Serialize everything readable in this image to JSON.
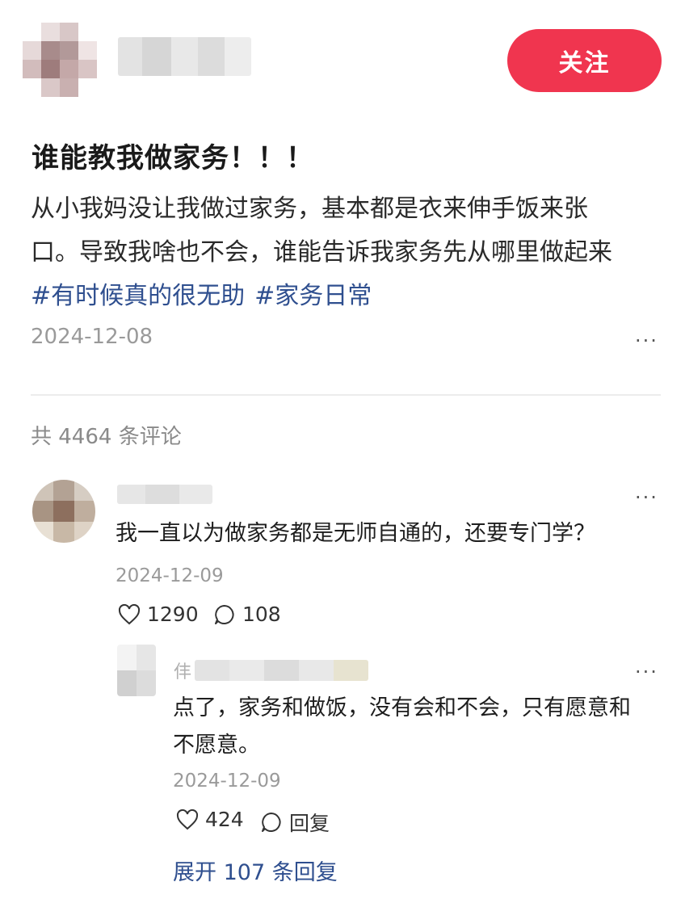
{
  "header": {
    "follow_label": "关注"
  },
  "post": {
    "title": "谁能教我做家务！！！",
    "body_lines": [
      "从小我妈没让我做过家务，基本都是衣来伸手饭来张",
      "口。导致我啥也不会，谁能告诉我家务先从哪里做起来"
    ],
    "hashtags": [
      "#有时候真的很无助",
      "#家务日常"
    ],
    "date": "2024-12-08",
    "more_label": "···"
  },
  "comments_header": {
    "count_text": "共 4464 条评论"
  },
  "comment": {
    "text": "我一直以为做家务都是无师自通的，还要专门学？",
    "date": "2024-12-09",
    "likes": "1290",
    "replies": "108",
    "more_label": "···"
  },
  "reply": {
    "author_initial": "仹",
    "text_lines": [
      "点了，家务和做饭，没有会和不会，只有愿意和",
      "不愿意。"
    ],
    "date": "2024-12-09",
    "likes": "424",
    "reply_label": "回复",
    "more_label": "···"
  },
  "expand": {
    "label": "展开 107 条回复"
  },
  "icons": {
    "like": "heart-icon",
    "comment": "comment-bubble-icon",
    "more": "more-dots-icon"
  },
  "colors": {
    "accent": "#f0354f",
    "link": "#2f4f8f",
    "muted": "#9a9a9a"
  }
}
